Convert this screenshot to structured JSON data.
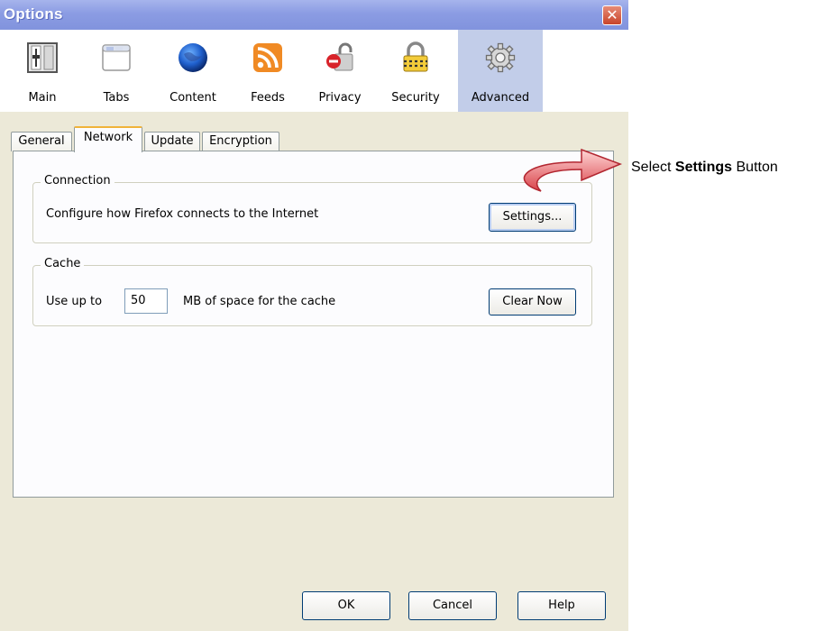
{
  "window": {
    "title": "Options",
    "close_label": "✕"
  },
  "toolbar": {
    "items": [
      {
        "label": "Main",
        "icon": "switch-icon"
      },
      {
        "label": "Tabs",
        "icon": "tabs-window-icon"
      },
      {
        "label": "Content",
        "icon": "globe-icon"
      },
      {
        "label": "Feeds",
        "icon": "rss-icon"
      },
      {
        "label": "Privacy",
        "icon": "padlock-no-entry-icon"
      },
      {
        "label": "Security",
        "icon": "padlock-icon"
      },
      {
        "label": "Advanced",
        "icon": "gear-icon"
      }
    ],
    "selected": "Advanced"
  },
  "tabs": [
    {
      "label": "General"
    },
    {
      "label": "Network"
    },
    {
      "label": "Update"
    },
    {
      "label": "Encryption"
    }
  ],
  "connection": {
    "legend": "Connection",
    "description": "Configure how Firefox connects to the Internet",
    "settings_label": "Settings..."
  },
  "cache": {
    "legend": "Cache",
    "use_up_to": "Use up to",
    "value": "50",
    "suffix": "MB of space for the cache",
    "clear_label": "Clear Now"
  },
  "footer": {
    "ok": "OK",
    "cancel": "Cancel",
    "help": "Help"
  },
  "annotation": {
    "prefix": "Select ",
    "bold": "Settings",
    "suffix": " Button"
  },
  "colors": {
    "titlebar": "#8b9ce3",
    "selected_toolbar": "#c2cde9",
    "dialog_bg": "#ece9d8",
    "arrow": "#d9434a"
  }
}
